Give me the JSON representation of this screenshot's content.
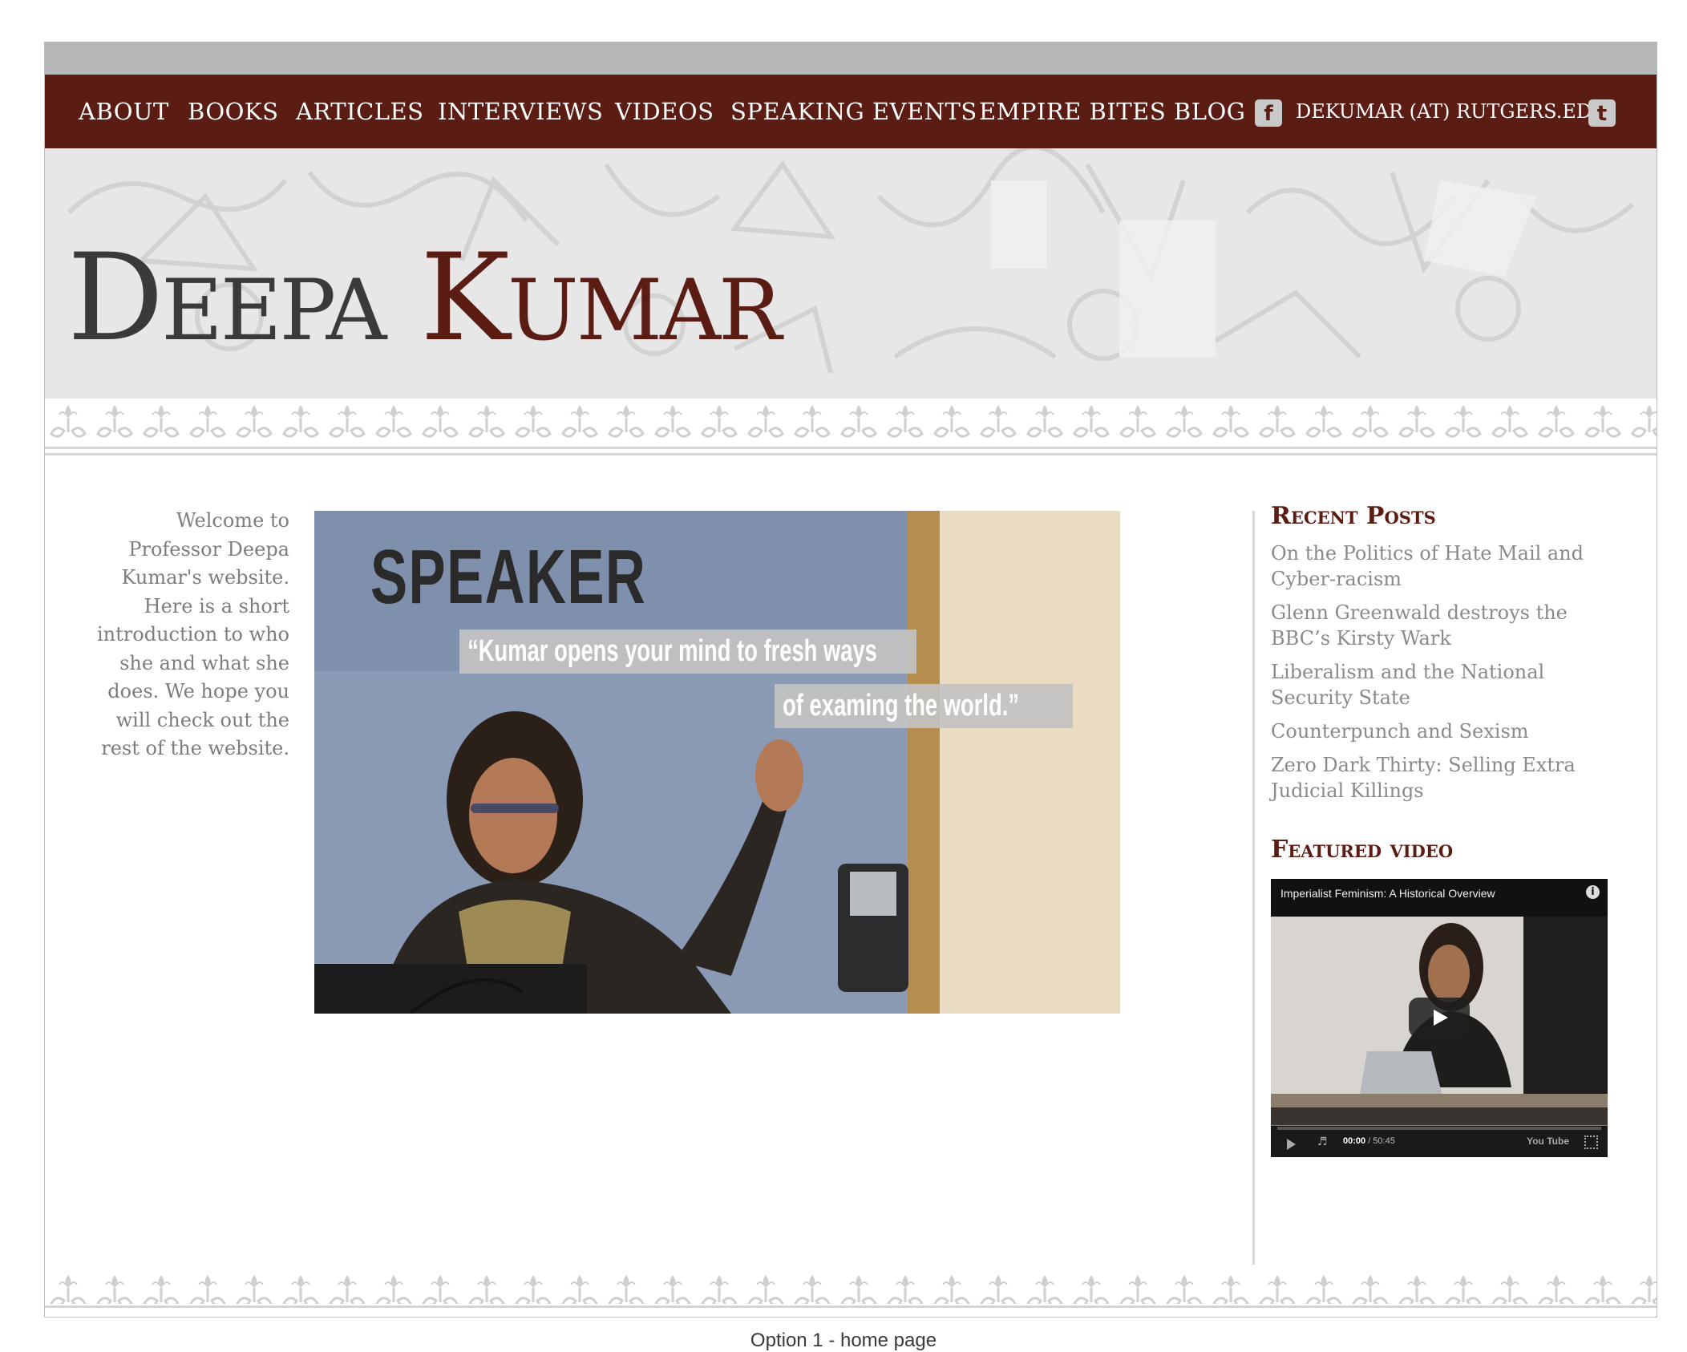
{
  "nav": {
    "items": [
      {
        "label": "ABOUT"
      },
      {
        "label": "BOOKS"
      },
      {
        "label": "ARTICLES"
      },
      {
        "label": "INTERVIEWS"
      },
      {
        "label": "VIDEOS"
      },
      {
        "label": "SPEAKING EVENTS"
      },
      {
        "label": "EMPIRE BITES BLOG"
      }
    ],
    "email": "DEKUMAR (AT) RUTGERS.EDU",
    "facebook_icon": "f",
    "twitter_icon": "t"
  },
  "header": {
    "first_name": "Deepa",
    "last_name": "Kumar"
  },
  "welcome": "Welcome to Professor Deepa Kumar's website. Here is a short introduction to who she and what she does. We hope you will check out the rest of the website.",
  "hero": {
    "title": "SPEAKER",
    "quote_line_1": "“Kumar opens your mind to fresh ways",
    "quote_line_2": "of examing the world.”"
  },
  "sidebar": {
    "recent_heading": "Recent Posts",
    "recent_posts": [
      "On the Politics of Hate Mail and Cyber-racism",
      "Glenn Greenwald destroys the BBC’s Kirsty Wark",
      "Liberalism and the National Security State",
      "Counterpunch and Sexism",
      "Zero Dark Thirty: Selling Extra Judicial Killings"
    ],
    "featured_heading": "Featured video",
    "video": {
      "title": "Imperialist Feminism: A Historical Overview",
      "info": "i",
      "time_current": "00:00",
      "time_total": " / 50:45",
      "youtube": "You Tube"
    }
  },
  "caption": "Option 1 - home page",
  "colors": {
    "accent": "#5b1c14",
    "topbar": "#b6b7b9",
    "text_gray": "#7d7d7d"
  }
}
